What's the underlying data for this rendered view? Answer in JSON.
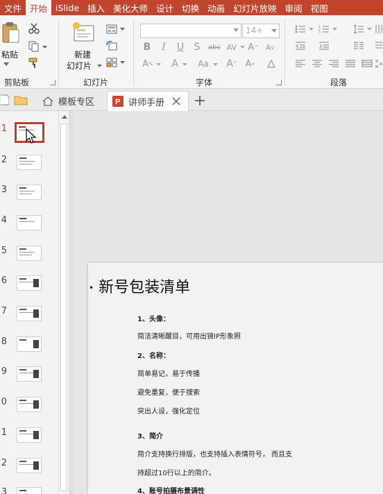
{
  "menu": {
    "tabs": [
      "文件",
      "开始",
      "iSlide",
      "插入",
      "美化大师",
      "设计",
      "切换",
      "动画",
      "幻灯片放映",
      "审阅",
      "视图"
    ],
    "active_index": 1,
    "accent": "#c0452c"
  },
  "ribbon": {
    "clipboard": {
      "paste_label": "粘贴",
      "group_label": "剪贴板"
    },
    "slides": {
      "new_slide_line1": "新建",
      "new_slide_line2": "幻灯片",
      "group_label": "幻灯片"
    },
    "font": {
      "font_name_value": "",
      "font_size_value": "14+",
      "group_label": "字体"
    },
    "paragraph": {
      "group_label": "段落"
    }
  },
  "tabs": [
    {
      "label": "模板专区",
      "icon": "home-icon"
    },
    {
      "label": "讲师手册",
      "icon": "powerpoint-icon",
      "active": true
    }
  ],
  "thumbnails": {
    "numbers": [
      "1",
      "2",
      "3",
      "4",
      "5",
      "6",
      "7",
      "8",
      "9",
      "0",
      "1",
      "2",
      "3"
    ],
    "selected_index": 0
  },
  "slide": {
    "title": "新号包装清单",
    "lines": [
      "1、头像：",
      "简洁清晰醒目，可用出镜IP形象照",
      "2、名称：",
      "简单易记，易于传播",
      "避免重复，便于搜索",
      "突出人设，强化定位",
      "3、简介",
      "简介支持换行排版，也支持插入表情符号， 而且支",
      "持超过10行以上的简介。",
      "4、账号拍摄布景调性"
    ]
  }
}
